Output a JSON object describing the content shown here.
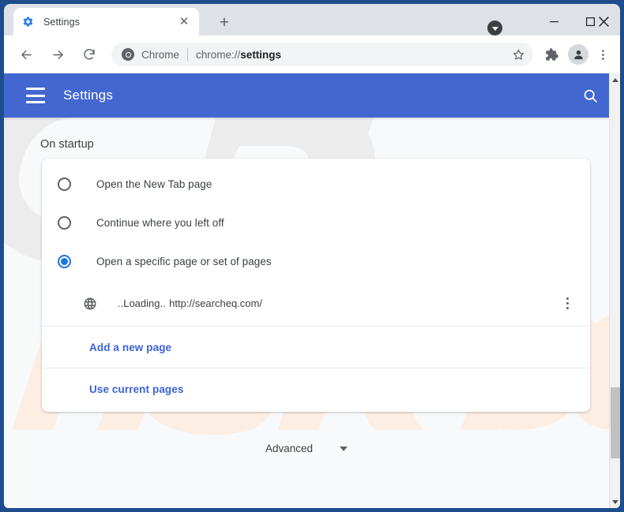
{
  "window": {
    "caption_dot_icon": "dropdown-circle-icon",
    "minimize_label": "–",
    "maximize_label": "□",
    "close_label": "✕"
  },
  "tabs": {
    "active": {
      "title": "Settings",
      "favicon": "gear-icon",
      "close_label": "✕"
    },
    "new_tab_label": "+"
  },
  "toolbar": {
    "back_icon": "arrow-left-icon",
    "forward_icon": "arrow-right-icon",
    "reload_icon": "reload-icon",
    "omnibox": {
      "badge_icon": "chrome-icon",
      "scheme": "Chrome",
      "url_prefix": "chrome://",
      "url_bold": "settings",
      "full_url": "chrome://settings"
    },
    "star_icon": "star-icon",
    "extensions_icon": "puzzle-piece-icon",
    "profile_icon": "person-icon",
    "menu_icon": "three-dots-vertical-icon"
  },
  "settings": {
    "header": {
      "menu_icon": "hamburger-icon",
      "title": "Settings",
      "search_icon": "search-icon"
    },
    "section_label": "On startup",
    "startup_options": [
      {
        "label": "Open the New Tab page",
        "checked": false
      },
      {
        "label": "Continue where you left off",
        "checked": false
      },
      {
        "label": "Open a specific page or set of pages",
        "checked": true
      }
    ],
    "startup_page": {
      "favicon": "globe-icon",
      "name": "..Loading..",
      "url": "http://searcheq.com/",
      "menu_icon": "three-dots-vertical-icon"
    },
    "links": {
      "add_new_page": "Add a new page",
      "use_current_pages": "Use current pages"
    },
    "advanced": {
      "label": "Advanced",
      "caret_icon": "chevron-down-icon"
    }
  },
  "scrollbar": {
    "up_icon": "triangle-up-icon",
    "down_icon": "triangle-down-icon"
  },
  "watermark": {
    "text": "risk.com",
    "logo": "PC",
    "color_logo": "#ececec",
    "color_text": "#fdeee3"
  },
  "colors": {
    "window_border": "#1d4d8c",
    "tabstrip_bg": "#dee1e6",
    "settings_header_blue": "#4367d0",
    "accent_blue": "#1a73e8",
    "link_blue": "#3a63d8",
    "page_bg": "#f8f9fa"
  }
}
